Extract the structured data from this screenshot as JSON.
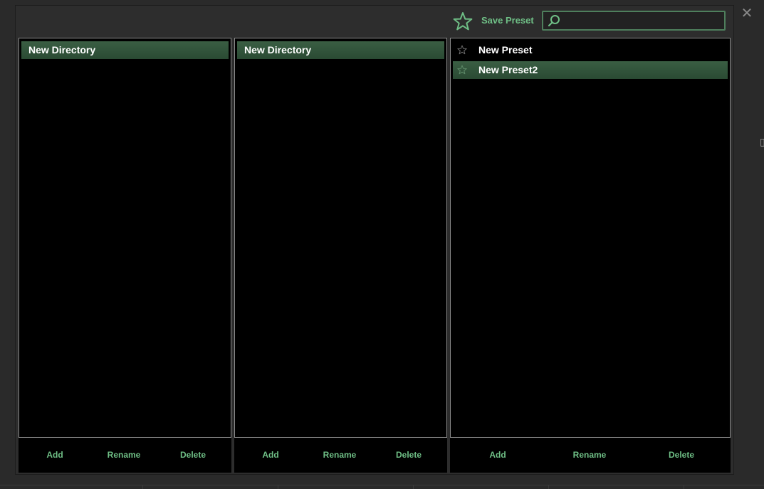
{
  "toolbar": {
    "save_preset_label": "Save Preset",
    "search_value": "",
    "search_placeholder": ""
  },
  "columns": [
    {
      "items": [
        {
          "label": "New Directory",
          "selected": true
        }
      ],
      "footer": {
        "add": "Add",
        "rename": "Rename",
        "delete": "Delete"
      }
    },
    {
      "items": [
        {
          "label": "New Directory",
          "selected": true
        }
      ],
      "footer": {
        "add": "Add",
        "rename": "Rename",
        "delete": "Delete"
      }
    },
    {
      "items": [
        {
          "label": "New Preset",
          "selected": false,
          "favorite": false
        },
        {
          "label": "New Preset2",
          "selected": true,
          "favorite": false
        }
      ],
      "footer": {
        "add": "Add",
        "rename": "Rename",
        "delete": "Delete"
      }
    }
  ],
  "colors": {
    "accent": "#6fbf86",
    "selection": "#2f5238",
    "panel_bg": "#000000",
    "dialog_bg": "#2d2d2d"
  }
}
